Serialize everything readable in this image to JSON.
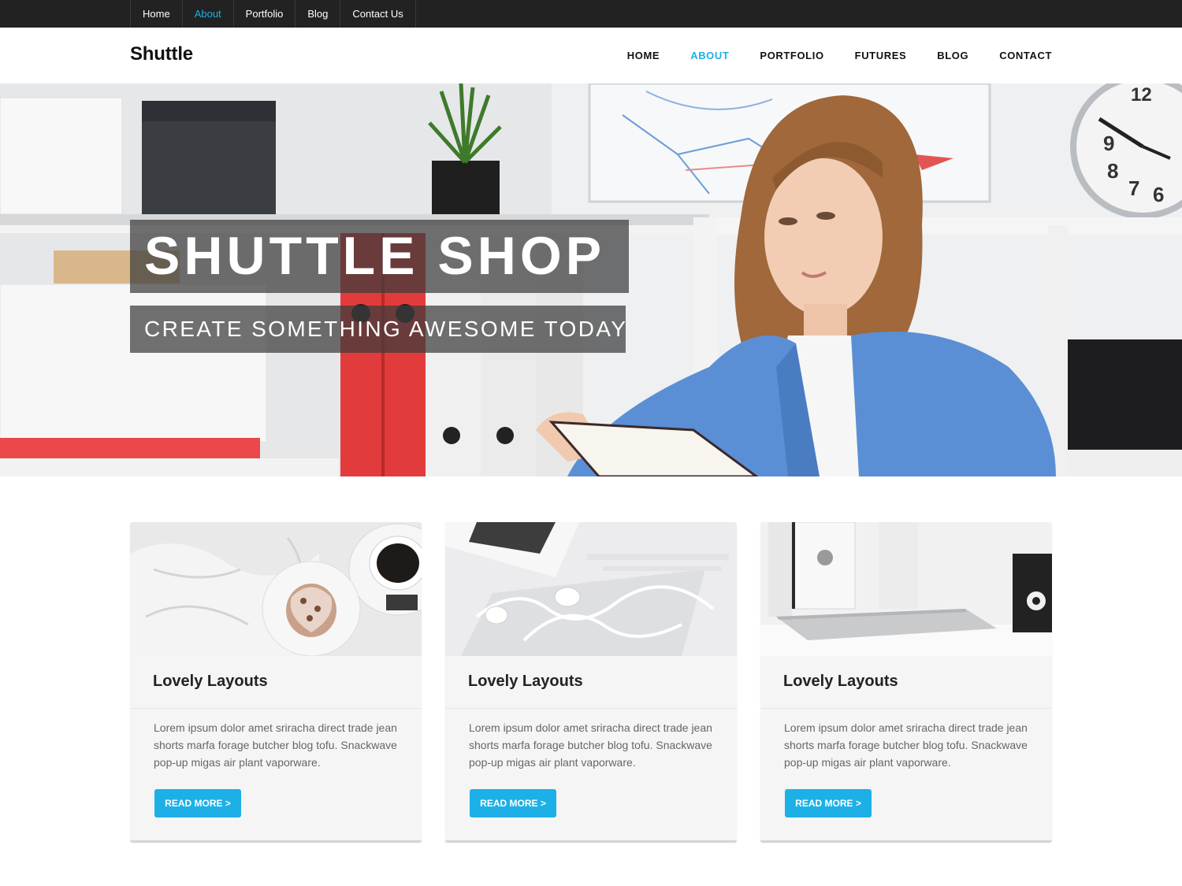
{
  "topbar": {
    "links": [
      {
        "label": "Home",
        "active": false
      },
      {
        "label": "About",
        "active": true
      },
      {
        "label": "Portfolio",
        "active": false
      },
      {
        "label": "Blog",
        "active": false
      },
      {
        "label": "Contact Us",
        "active": false
      }
    ]
  },
  "header": {
    "logo": "Shuttle",
    "nav": [
      {
        "label": "HOME",
        "active": false
      },
      {
        "label": "ABOUT",
        "active": true
      },
      {
        "label": "PORTFOLIO",
        "active": false
      },
      {
        "label": "FUTURES",
        "active": false
      },
      {
        "label": "BLOG",
        "active": false
      },
      {
        "label": "CONTACT",
        "active": false
      }
    ]
  },
  "hero": {
    "title": "SHUTTLE SHOP",
    "subtitle": "CREATE SOMETHING AWESOME TODAY"
  },
  "cards": [
    {
      "image": "dessert-and-coffee-photo",
      "title": "Lovely Layouts",
      "text": "Lorem ipsum dolor amet sriracha direct trade jean shorts marfa forage butcher blog tofu. Snackwave pop-up migas air plant vaporware.",
      "button": "READ MORE >"
    },
    {
      "image": "earphones-photo",
      "title": "Lovely Layouts",
      "text": "Lorem ipsum dolor amet sriracha direct trade jean shorts marfa forage butcher blog tofu. Snackwave pop-up migas air plant vaporware.",
      "button": "READ MORE >"
    },
    {
      "image": "laptop-and-books-photo",
      "title": "Lovely Layouts",
      "text": "Lorem ipsum dolor amet sriracha direct trade jean shorts marfa forage butcher blog tofu. Snackwave pop-up migas air plant vaporware.",
      "button": "READ MORE >"
    }
  ],
  "colors": {
    "accent": "#1cb0e6",
    "topbar_bg": "#222222",
    "card_bg": "#f5f5f5"
  }
}
